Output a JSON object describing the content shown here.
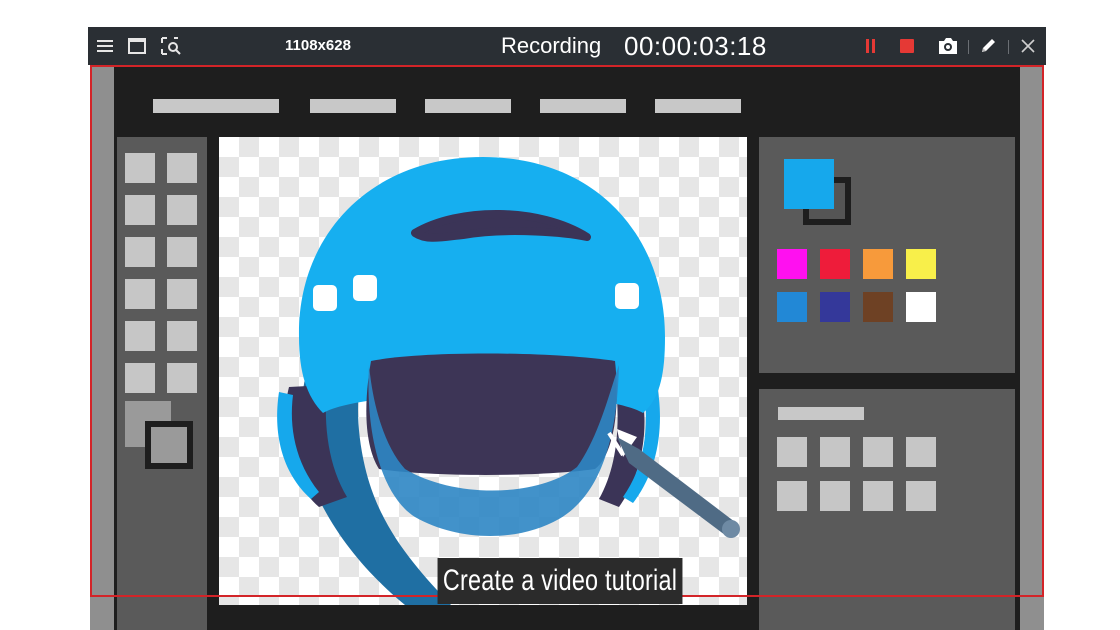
{
  "toolbar": {
    "dimensions": "1108x628",
    "recording_label": "Recording",
    "timer": "00:00:03:18",
    "icons": [
      "menu-icon",
      "window-icon",
      "region-select-icon",
      "pause-icon",
      "stop-icon",
      "camera-icon",
      "pencil-icon",
      "close-icon"
    ],
    "colors": {
      "background": "#2a2f34",
      "pause": "#e53935",
      "stop": "#e53935",
      "border": "#d32428"
    }
  },
  "palette": {
    "primary_color": "#16a8ec",
    "secondary_color": "#555555",
    "swatches": [
      "#ff10f0",
      "#ee1c3a",
      "#f79a3b",
      "#f8ef4a",
      "#2288d6",
      "#34389a",
      "#6e4124",
      "#ffffff"
    ]
  },
  "caption": "Create a video tutorial"
}
